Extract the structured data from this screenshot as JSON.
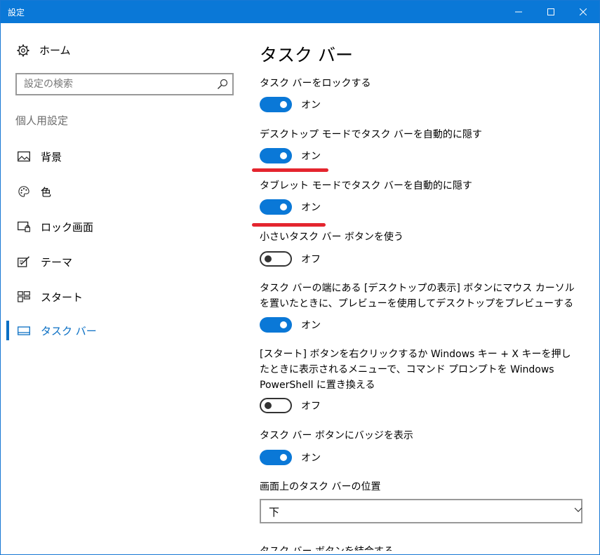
{
  "window": {
    "title": "設定"
  },
  "sidebar": {
    "home_label": "ホーム",
    "search_placeholder": "設定の検索",
    "section_label": "個人用設定",
    "items": [
      {
        "label": "背景",
        "icon": "picture-icon"
      },
      {
        "label": "色",
        "icon": "palette-icon"
      },
      {
        "label": "ロック画面",
        "icon": "lock-screen-icon"
      },
      {
        "label": "テーマ",
        "icon": "theme-icon"
      },
      {
        "label": "スタート",
        "icon": "start-icon"
      },
      {
        "label": "タスク バー",
        "icon": "taskbar-icon",
        "active": true
      }
    ]
  },
  "content": {
    "title": "タスク バー",
    "settings": [
      {
        "label": "タスク バーをロックする",
        "state": "オン",
        "on": true
      },
      {
        "label": "デスクトップ モードでタスク バーを自動的に隠す",
        "state": "オン",
        "on": true
      },
      {
        "label": "タブレット モードでタスク バーを自動的に隠す",
        "state": "オン",
        "on": true
      },
      {
        "label": "小さいタスク バー ボタンを使う",
        "state": "オフ",
        "on": false
      },
      {
        "label": "タスク バーの端にある [デスクトップの表示] ボタンにマウス カーソルを置いたときに、プレビューを使用してデスクトップをプレビューする",
        "state": "オン",
        "on": true
      },
      {
        "label": "[スタート] ボタンを右クリックするか Windows キー + X キーを押したときに表示されるメニューで、コマンド プロンプトを Windows PowerShell に置き換える",
        "state": "オフ",
        "on": false
      },
      {
        "label": "タスク バー ボタンにバッジを表示",
        "state": "オン",
        "on": true
      }
    ],
    "position_label": "画面上のタスク バーの位置",
    "position_value": "下",
    "next_label_partial": "タスク バー ボタンを結合する"
  },
  "colors": {
    "accent": "#0a78d7",
    "annotation": "#e4252e"
  }
}
